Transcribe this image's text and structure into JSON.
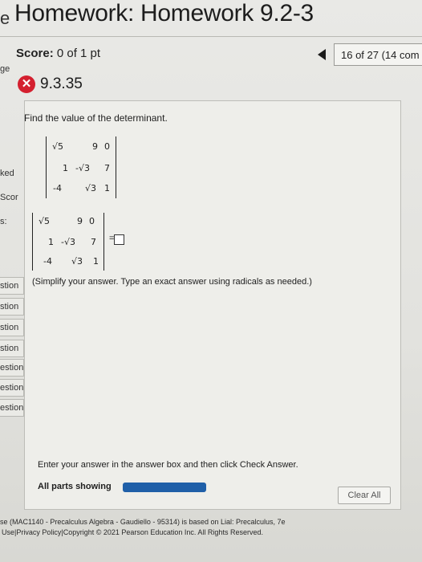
{
  "header": {
    "prefix": "e",
    "title": "Homework: Homework 9.2-3"
  },
  "score": {
    "label": "Score:",
    "value": "0 of 1 pt"
  },
  "navigation": {
    "position": "16 of 27 (14 com"
  },
  "sidebar": {
    "labels": [
      "ge",
      "ked",
      "Scor",
      "s:"
    ],
    "tabs": [
      "stion",
      "stion",
      "stion",
      "stion",
      "estion",
      "estion",
      "estion"
    ]
  },
  "question": {
    "number": "9.3.35",
    "prompt": "Find the value of the determinant.",
    "matrix": [
      [
        "√5",
        "9",
        "0"
      ],
      [
        "1",
        "-√3",
        "7"
      ],
      [
        "-4",
        "√3",
        "1"
      ]
    ],
    "equals": "=",
    "hint": "(Simplify your answer. Type an exact answer using radicals as needed.)"
  },
  "bottom": {
    "instruction": "Enter your answer in the answer box and then click Check Answer.",
    "parts_label": "All parts showing",
    "clear_button": "Clear All"
  },
  "footer": {
    "line1": "se (MAC1140 - Precalculus Algebra - Gaudiello - 95314) is based on Lial: Precalculus, 7e",
    "line2": "Use|Privacy Policy|Copyright © 2021 Pearson Education Inc. All Rights Reserved."
  },
  "colors": {
    "error": "#d4202f",
    "progress": "#1f5fa8"
  }
}
